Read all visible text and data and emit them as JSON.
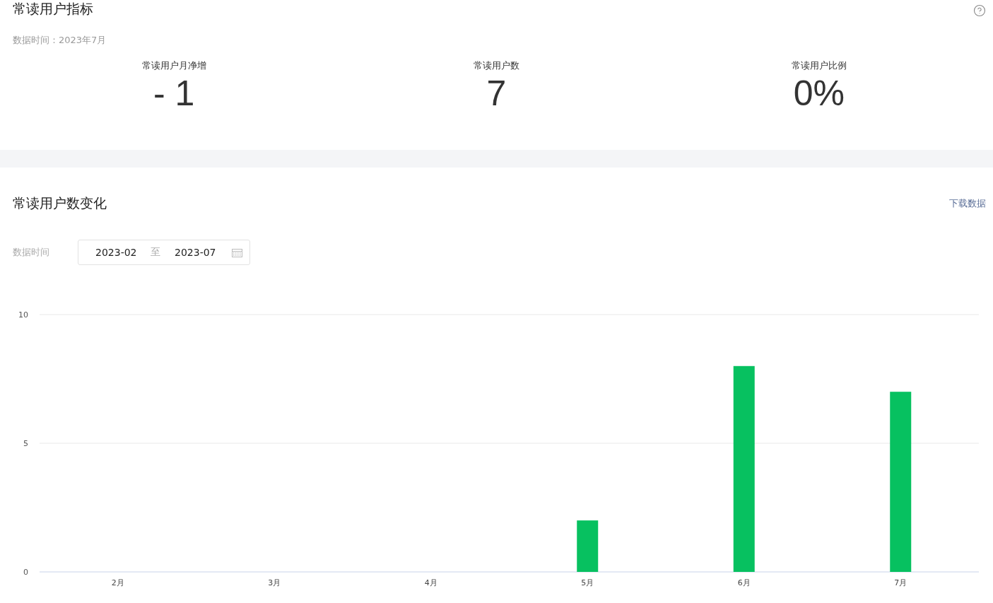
{
  "metrics_section": {
    "title": "常读用户指标",
    "data_time": "数据时间：2023年7月",
    "metrics": [
      {
        "label": "常读用户月净增",
        "value": "- 1"
      },
      {
        "label": "常读用户数",
        "value": "7"
      },
      {
        "label": "常读用户比例",
        "value": "0%"
      }
    ]
  },
  "trend_section": {
    "title": "常读用户数变化",
    "download_link": "下载数据",
    "filter_label": "数据时间",
    "start_date": "2023-02",
    "separator": "至",
    "end_date": "2023-07",
    "chart_data": {
      "type": "bar",
      "categories": [
        "2月",
        "3月",
        "4月",
        "5月",
        "6月",
        "7月"
      ],
      "series": [
        {
          "color": "#07c160",
          "values": [
            0,
            0,
            0,
            2,
            8,
            7
          ]
        }
      ],
      "ylim": [
        0,
        10
      ],
      "yticks": [
        0,
        5,
        10
      ]
    }
  }
}
